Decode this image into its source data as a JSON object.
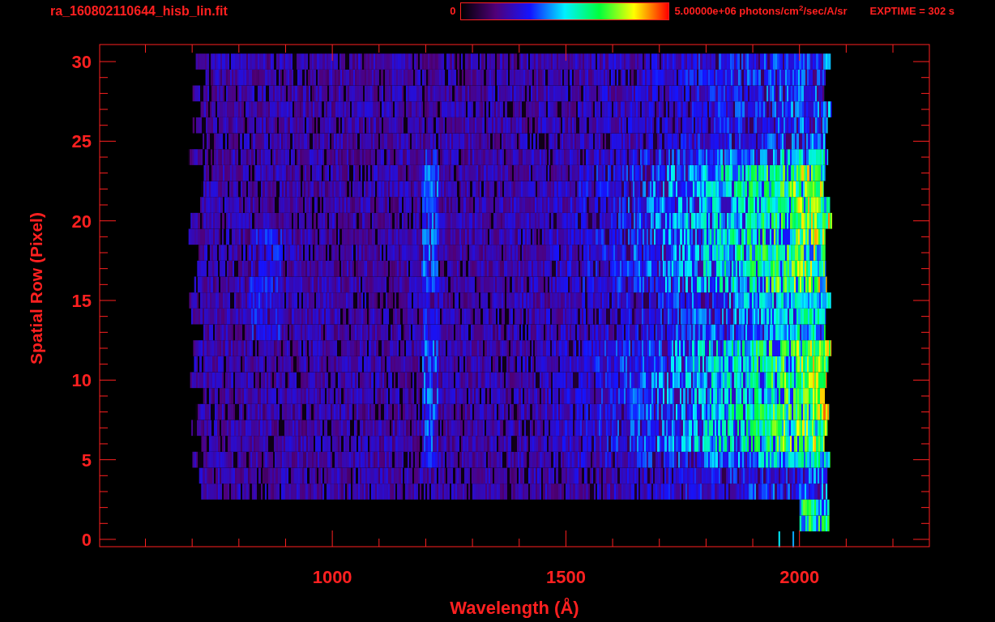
{
  "header": {
    "title": "ra_160802110644_hisb_lin.fit",
    "colorbar_min": "0",
    "colorbar_max": "5.00000e+06 photons/cm$^{2}$/sec/A/sr",
    "exposure": "EXPTIME = 302 s"
  },
  "plot": {
    "xlabel": "Wavelength (Å)",
    "ylabel": "Spatial Row (Pixel)",
    "xticks": [
      "1000",
      "1500",
      "2000"
    ],
    "yticks": [
      "30",
      "25",
      "20",
      "15",
      "10",
      "5",
      "0"
    ]
  }
}
